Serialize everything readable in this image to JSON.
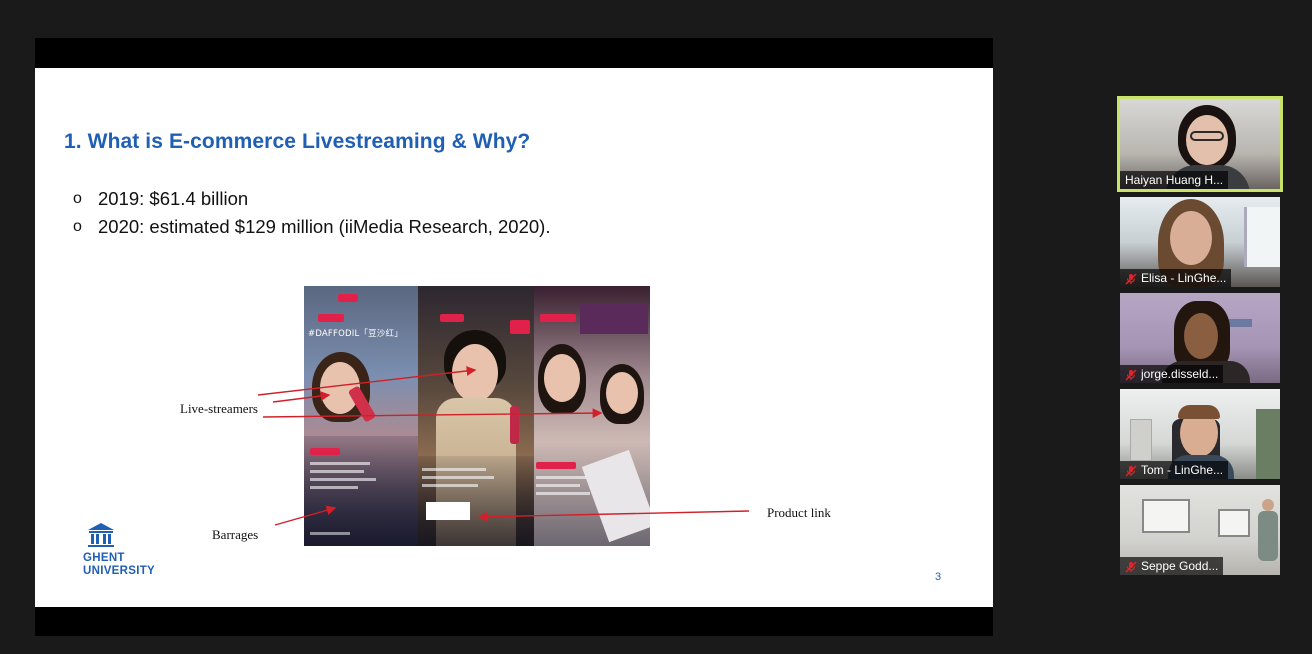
{
  "slide": {
    "title": "1. What is E-commerce Livestreaming & Why?",
    "bullets": [
      "2019: $61.4 billion",
      "2020: estimated $129 million (iiMedia Research, 2020)."
    ],
    "bullet_glyph": "o",
    "annotations": {
      "live_streamers": "Live-streamers",
      "barrages": "Barrages",
      "product_link": "Product link"
    },
    "image_text": {
      "daffodil": "#DAFFODIL「豆沙红」"
    },
    "logo": {
      "line1": "GHENT",
      "line2": "UNIVERSITY"
    },
    "page_number": "3",
    "accent_color": "#1f5fb4"
  },
  "participants": [
    {
      "name": "Haiyan Huang H...",
      "muted": false,
      "active_speaker": true
    },
    {
      "name": "Elisa - LinGhe...",
      "muted": true,
      "active_speaker": false
    },
    {
      "name": "jorge.disseld...",
      "muted": true,
      "active_speaker": false
    },
    {
      "name": "Tom - LinGhe...",
      "muted": true,
      "active_speaker": false
    },
    {
      "name": "Seppe Godd...",
      "muted": true,
      "active_speaker": false
    }
  ],
  "colors": {
    "active_border": "#c9e26a",
    "muted_icon": "#e0242a",
    "background": "#1a1a1a"
  }
}
